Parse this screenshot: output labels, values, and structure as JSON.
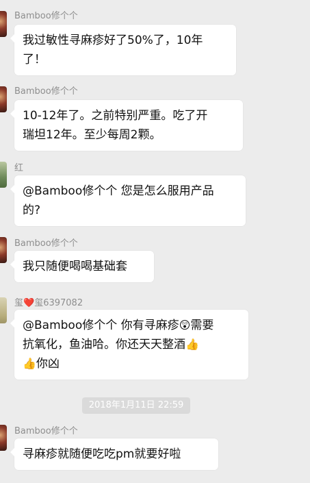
{
  "messages": [
    {
      "sender": "Bamboo修个个",
      "text_lines": [
        "我过敏性寻麻疹好了50%了，10年",
        "了！"
      ]
    },
    {
      "sender": "Bamboo修个个",
      "text_lines": [
        "10-12年了。之前特别严重。吃了开",
        "瑞坦12年。至少每周2颗。"
      ]
    },
    {
      "sender": "红",
      "text_lines": [
        "@Bamboo修个个 您是怎么服用产品",
        "的?"
      ]
    },
    {
      "sender": "Bamboo修个个",
      "text_lines": [
        "我只随便喝喝基础套"
      ]
    },
    {
      "sender_prefix": "玺",
      "sender_heart": "❤️",
      "sender_suffix": "玺6397082",
      "line1": "@Bamboo修个个 你有寻麻疹",
      "emoji1": "😲",
      "line1b": "需要",
      "line2": "抗氧化，鱼油哈。你还天天整酒",
      "emoji2": "👍",
      "emoji3": "👍",
      "line3": "你凶"
    },
    {
      "sender": "Bamboo修个个",
      "text_lines": [
        "寻麻疹就随便吃吃pm就要好啦"
      ]
    }
  ],
  "timestamp": "2018年1月11日 22:59"
}
